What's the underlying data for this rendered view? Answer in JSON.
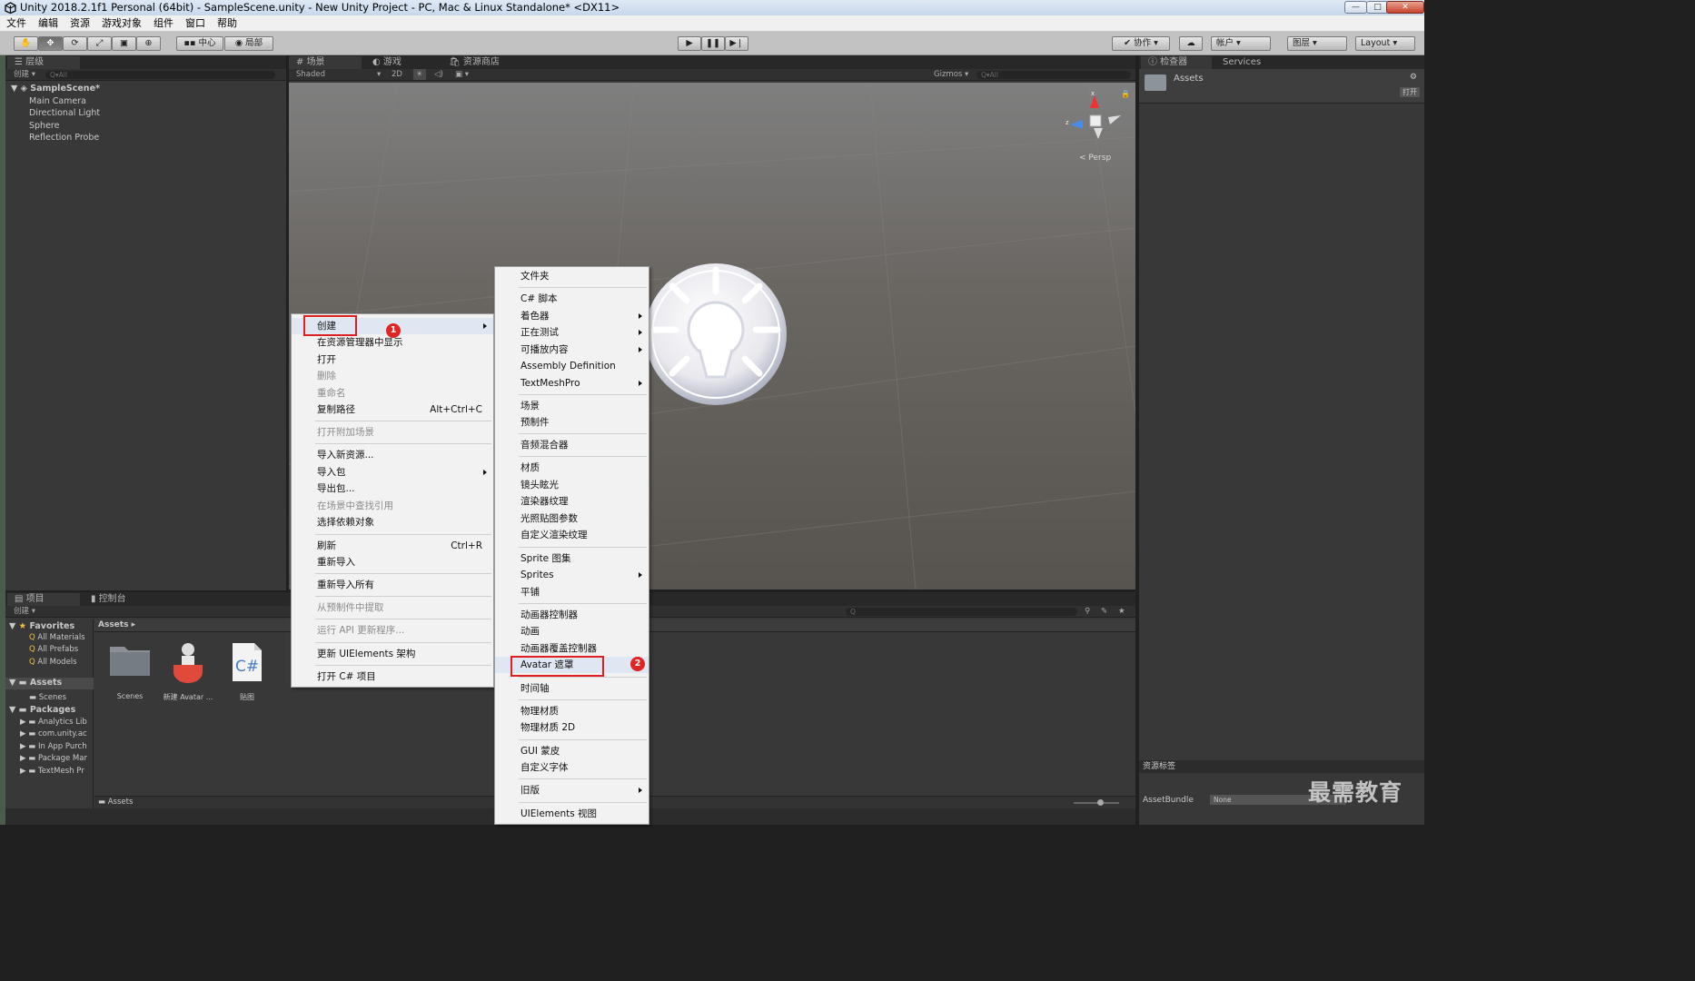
{
  "window": {
    "title": "Unity 2018.2.1f1 Personal (64bit) - SampleScene.unity - New Unity Project - PC, Mac & Linux Standalone* <DX11>",
    "min": "—",
    "max": "□",
    "close": "✕"
  },
  "menubar": [
    "文件",
    "编辑",
    "资源",
    "游戏对象",
    "组件",
    "窗口",
    "帮助"
  ],
  "toolbar": {
    "pivot": "中心",
    "space": "局部",
    "collab": "协作",
    "account": "帐户",
    "layers": "图层",
    "layout": "Layout"
  },
  "hierarchy": {
    "tab": "层级",
    "create": "创建",
    "search": "Q▾All",
    "scene": "SampleScene*",
    "items": [
      "Main Camera",
      "Directional Light",
      "Sphere",
      "Reflection Probe"
    ]
  },
  "scene": {
    "tabs": [
      "场景",
      "游戏",
      "资源商店"
    ],
    "shading": "Shaded",
    "mode2d": "2D",
    "gizmos": "Gizmos",
    "search": "Q▾All",
    "persp": "Persp",
    "axis_x": "x",
    "axis_z": "z"
  },
  "inspector": {
    "tabs": [
      "检查器",
      "Services"
    ],
    "asset": "Assets",
    "open": "打开",
    "labels_title": "资源标签",
    "assetbundle_label": "AssetBundle",
    "assetbundle_value": "None"
  },
  "project": {
    "tabs": [
      "项目",
      "控制台"
    ],
    "create": "创建",
    "breadcrumb": "Assets",
    "footer_path": "Assets",
    "favorites": "Favorites",
    "fav_items": [
      "All Materials",
      "All Prefabs",
      "All Models"
    ],
    "assets_root": "Assets",
    "assets_children": [
      "Scenes"
    ],
    "packages_root": "Packages",
    "packages": [
      "Analytics Lib",
      "com.unity.ac",
      "In App Purch",
      "Package Mar",
      "TextMesh Pr"
    ],
    "grid": [
      {
        "name": "Scenes",
        "icon": "folder-icon"
      },
      {
        "name": "新建 Avatar ...",
        "icon": "avatar-mask-icon"
      },
      {
        "name": "贴图",
        "icon": "csharp-script-icon"
      }
    ]
  },
  "context_menu": {
    "items": [
      {
        "label": "创建",
        "arrow": true
      },
      {
        "label": "在资源管理器中显示"
      },
      {
        "label": "打开"
      },
      {
        "label": "删除",
        "disabled": true
      },
      {
        "label": "重命名",
        "disabled": true
      },
      {
        "label": "复制路径",
        "shortcut": "Alt+Ctrl+C"
      },
      {
        "label": "打开附加场景",
        "disabled": true
      },
      {
        "label": "导入新资源..."
      },
      {
        "label": "导入包",
        "arrow": true
      },
      {
        "label": "导出包..."
      },
      {
        "label": "在场景中查找引用",
        "disabled": true
      },
      {
        "label": "选择依赖对象"
      },
      {
        "label": "刷新",
        "shortcut": "Ctrl+R"
      },
      {
        "label": "重新导入"
      },
      {
        "label": "重新导入所有"
      },
      {
        "label": "从预制件中提取",
        "disabled": true
      },
      {
        "label": "运行 API 更新程序...",
        "disabled": true
      },
      {
        "label": "更新 UIElements 架构"
      },
      {
        "label": "打开 C# 项目"
      }
    ]
  },
  "submenu": {
    "items": [
      {
        "label": "文件夹"
      },
      {
        "label": "C# 脚本"
      },
      {
        "label": "着色器",
        "arrow": true
      },
      {
        "label": "正在测试",
        "arrow": true
      },
      {
        "label": "可播放内容",
        "arrow": true
      },
      {
        "label": "Assembly Definition"
      },
      {
        "label": "TextMeshPro",
        "arrow": true
      },
      {
        "label": "场景"
      },
      {
        "label": "预制件"
      },
      {
        "label": "音频混合器"
      },
      {
        "label": "材质"
      },
      {
        "label": "镜头眩光"
      },
      {
        "label": "渲染器纹理"
      },
      {
        "label": "光照贴图参数"
      },
      {
        "label": "自定义渲染纹理"
      },
      {
        "label": "Sprite 图集"
      },
      {
        "label": "Sprites",
        "arrow": true
      },
      {
        "label": "平铺"
      },
      {
        "label": "动画器控制器"
      },
      {
        "label": "动画"
      },
      {
        "label": "动画器覆盖控制器"
      },
      {
        "label": "Avatar 遮罩"
      },
      {
        "label": "时间轴"
      },
      {
        "label": "物理材质"
      },
      {
        "label": "物理材质 2D"
      },
      {
        "label": "GUI 蒙皮"
      },
      {
        "label": "自定义字体"
      },
      {
        "label": "旧版",
        "arrow": true
      },
      {
        "label": "UIElements 视图"
      }
    ]
  },
  "annotations": {
    "badge1": "1",
    "badge2": "2"
  },
  "watermark": "最需教育",
  "colors": {
    "menu_bg": "#f2f2f2",
    "highlight": "#e02020",
    "panel": "#383838",
    "scene_bg": "#6b6763"
  }
}
